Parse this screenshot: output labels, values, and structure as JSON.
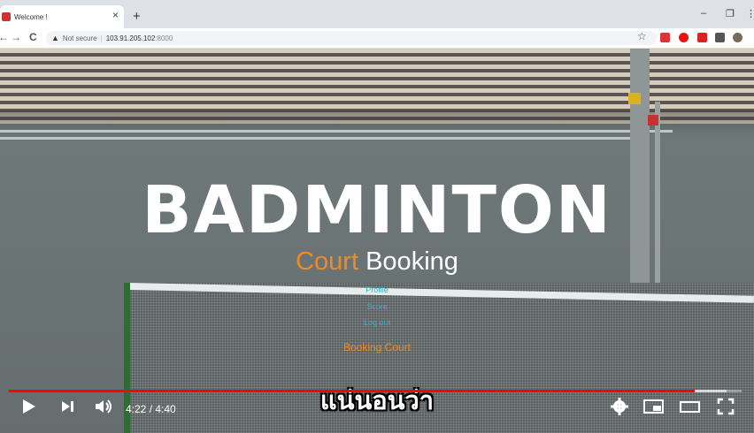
{
  "browser": {
    "tab_title": "Welcome !",
    "tab_close": "×",
    "new_tab": "+",
    "minimize": "–",
    "restore": "❐",
    "more": "⋮",
    "back": "←",
    "forward": "→",
    "reload": "C",
    "security_icon": "▲",
    "security_label": "Not secure",
    "url_host": "103.91.205.102",
    "url_port": ":8000",
    "bookmark": "☆"
  },
  "page": {
    "hero_title": "BADMINTON",
    "subtitle_accent": "Court",
    "subtitle_rest": " Booking",
    "menu": [
      "Profile",
      "Score",
      "Log out"
    ],
    "booking_link": "Booking Court"
  },
  "player": {
    "caption": "แน่นอนว่า",
    "current_time": "4:22",
    "duration": "4:40",
    "time_display": "4:22 / 4:40",
    "progress": 0.936,
    "buffered": 0.98
  },
  "colors": {
    "accent_orange": "#f08a24",
    "link_cyan": "#2fb3c0",
    "progress_red": "#ff0000"
  }
}
